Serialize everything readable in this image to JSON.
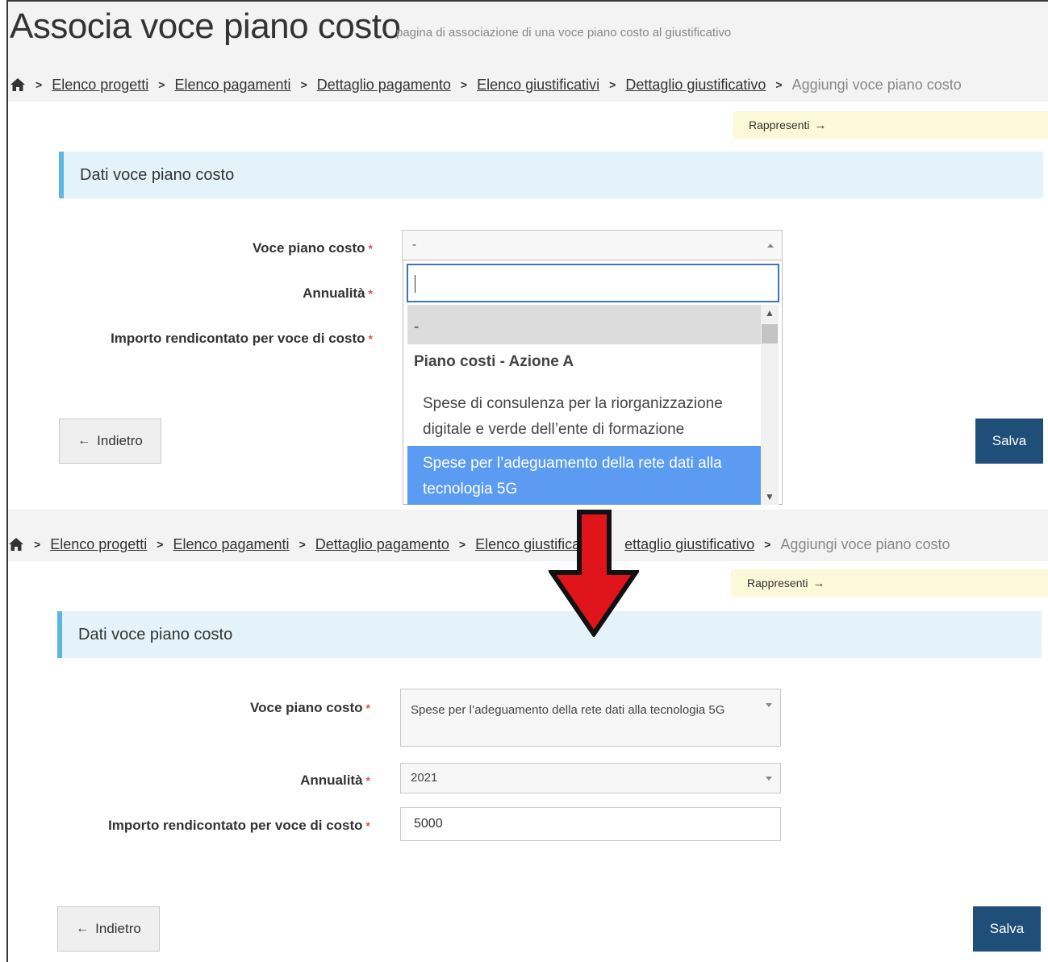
{
  "header": {
    "title": "Associa voce piano costo",
    "subtitle": "pagina di associazione di una voce piano costo al giustificativo"
  },
  "breadcrumb": {
    "items": [
      "Elenco progetti",
      "Elenco pagamenti",
      "Dettaglio pagamento",
      "Elenco giustificativi",
      "Dettaglio giustificativo"
    ],
    "current": "Aggiungi voce piano costo",
    "truncated_item": "Elenco giustificat",
    "partial_item": "ettaglio giustificativo"
  },
  "rappresenti_label": "Rappresenti",
  "section_title": "Dati voce piano costo",
  "form": {
    "voce_label": "Voce piano costo",
    "annualita_label": "Annualità",
    "importo_label": "Importo rendicontato per voce di costo",
    "required_mark": "*"
  },
  "step1": {
    "voce_value": "-",
    "dropdown": {
      "empty_option": "-",
      "group_label": "Piano costi - Azione A",
      "option_1": "Spese di consulenza per la riorganizzazione digitale e verde dell’ente di formazione",
      "option_2": "Spese per l’adeguamento della rete dati alla tecnologia 5G"
    }
  },
  "step2": {
    "voce_value": "Spese per l’adeguamento della rete dati alla tecnologia 5G",
    "annualita_value": "2021",
    "importo_value": "5000"
  },
  "buttons": {
    "back": "Indietro",
    "save": "Salva"
  },
  "colors": {
    "accent_blue": "#1f4e79",
    "highlight_blue": "#5b9cf2",
    "section_bar": "#e4f3fa",
    "required_red": "#d9534f",
    "arrow_red": "#e0141b"
  },
  "icons": {
    "home": "home-icon",
    "back_arrow": "arrow-left-icon",
    "right_arrow": "arrow-right-icon",
    "transition": "big-red-down-arrow"
  }
}
